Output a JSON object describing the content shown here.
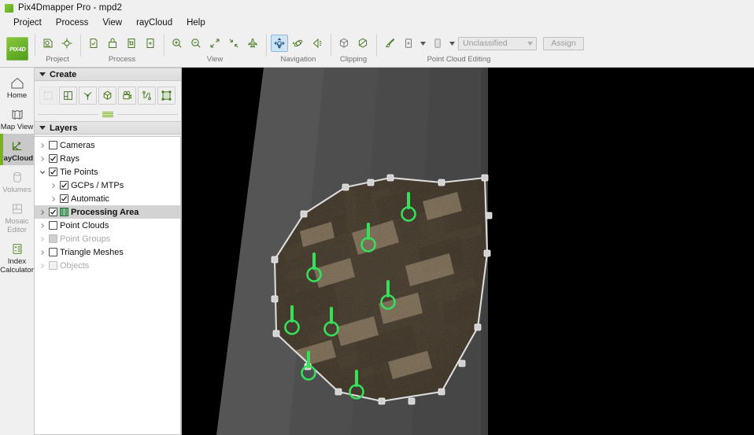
{
  "window": {
    "title": "Pix4Dmapper Pro - mpd2",
    "app_icon": "pix4d-logo-icon",
    "logo_text": "PIX4D"
  },
  "menubar": {
    "items": [
      {
        "label": "Project"
      },
      {
        "label": "Process"
      },
      {
        "label": "View"
      },
      {
        "label": "rayCloud"
      },
      {
        "label": "Help"
      }
    ]
  },
  "ribbon": {
    "groups": [
      {
        "label": "Project",
        "buttons": [
          {
            "name": "new-project-icon",
            "enabled": true,
            "active": false
          },
          {
            "name": "project-properties-icon",
            "enabled": true,
            "active": false
          }
        ]
      },
      {
        "label": "Process",
        "buttons": [
          {
            "name": "processing-options-icon",
            "enabled": true,
            "active": false
          },
          {
            "name": "local-processing-icon",
            "enabled": true,
            "active": false
          },
          {
            "name": "reoptimize-icon",
            "enabled": true,
            "active": false
          },
          {
            "name": "rematch-and-optimize-icon",
            "enabled": true,
            "active": false
          }
        ]
      },
      {
        "label": "View",
        "buttons": [
          {
            "name": "zoom-in-icon",
            "enabled": true,
            "active": false
          },
          {
            "name": "zoom-out-icon",
            "enabled": true,
            "active": false
          },
          {
            "name": "zoom-extents-icon",
            "enabled": true,
            "active": false
          },
          {
            "name": "zoom-selection-icon",
            "enabled": true,
            "active": false
          },
          {
            "name": "fly-through-icon",
            "enabled": true,
            "active": false
          }
        ]
      },
      {
        "label": "Navigation",
        "buttons": [
          {
            "name": "orbit-navigation-icon",
            "enabled": true,
            "active": true
          },
          {
            "name": "rotate-navigation-icon",
            "enabled": true,
            "active": false
          },
          {
            "name": "first-person-navigation-icon",
            "enabled": true,
            "active": false
          }
        ]
      },
      {
        "label": "Clipping",
        "buttons": [
          {
            "name": "clipping-box-icon",
            "enabled": true,
            "active": false
          },
          {
            "name": "clipping-plane-icon",
            "enabled": true,
            "active": false
          }
        ]
      },
      {
        "label": "Point Cloud Editing",
        "buttons": [
          {
            "name": "brush-tool-icon",
            "enabled": true,
            "active": false
          },
          {
            "name": "add-to-selection-icon",
            "enabled": true,
            "active": false
          },
          {
            "name": "selection-shape-icon",
            "enabled": true,
            "active": false
          }
        ],
        "classification_combo": {
          "name": "classification-combo",
          "value": "Unclassified",
          "enabled": false
        },
        "assign_button": {
          "name": "assign-button",
          "label": "Assign",
          "enabled": false
        }
      }
    ]
  },
  "rail": {
    "items": [
      {
        "label": "Home",
        "icon": "home-icon",
        "active": false,
        "enabled": true
      },
      {
        "label": "Map View",
        "icon": "map-view-icon",
        "active": false,
        "enabled": true
      },
      {
        "label": "rayCloud",
        "icon": "raycloud-icon",
        "active": true,
        "enabled": true
      },
      {
        "label": "Volumes",
        "icon": "volumes-icon",
        "active": false,
        "enabled": false
      },
      {
        "label": "Mosaic\nEditor",
        "icon": "mosaic-editor-icon",
        "active": false,
        "enabled": false
      },
      {
        "label": "Index\nCalculator",
        "icon": "index-calculator-icon",
        "active": false,
        "enabled": true
      }
    ],
    "labels": {
      "home": "Home",
      "map_view": "Map View",
      "raycloud": "rayCloud",
      "volumes": "Volumes",
      "mosaic_line1": "Mosaic",
      "mosaic_line2": "Editor",
      "index_line1": "Index",
      "index_line2": "Calculator"
    }
  },
  "create_panel": {
    "title": "Create",
    "collapsed": false,
    "buttons": [
      {
        "name": "create-selection-icon",
        "enabled": false
      },
      {
        "name": "create-orthoplane-icon",
        "enabled": true
      },
      {
        "name": "create-polyline-icon",
        "enabled": true
      },
      {
        "name": "create-object-icon",
        "enabled": true
      },
      {
        "name": "create-video-animation-icon",
        "enabled": true
      },
      {
        "name": "create-scale-constraint-icon",
        "enabled": true
      },
      {
        "name": "create-processing-area-icon",
        "enabled": true
      }
    ]
  },
  "layers_panel": {
    "title": "Layers",
    "collapsed": false,
    "rows": [
      {
        "label": "Cameras",
        "checked": false,
        "expanded": null,
        "indent": 0,
        "enabled": true,
        "selected": false,
        "icon": null
      },
      {
        "label": "Rays",
        "checked": true,
        "expanded": null,
        "indent": 0,
        "enabled": true,
        "selected": false,
        "icon": null
      },
      {
        "label": "Tie Points",
        "checked": true,
        "expanded": "open",
        "indent": 0,
        "enabled": true,
        "selected": false,
        "icon": null
      },
      {
        "label": "GCPs / MTPs",
        "checked": true,
        "expanded": "closed",
        "indent": 1,
        "enabled": true,
        "selected": false,
        "icon": null
      },
      {
        "label": "Automatic",
        "checked": true,
        "expanded": "closed",
        "indent": 1,
        "enabled": true,
        "selected": false,
        "icon": null
      },
      {
        "label": "Processing Area",
        "checked": true,
        "expanded": "closed",
        "indent": 0,
        "enabled": true,
        "selected": true,
        "icon": "processing-area-icon"
      },
      {
        "label": "Point Clouds",
        "checked": false,
        "expanded": "closed",
        "indent": 0,
        "enabled": true,
        "selected": false,
        "icon": null
      },
      {
        "label": "Point Groups",
        "checked": false,
        "expanded": "closed",
        "indent": 0,
        "enabled": false,
        "selected": false,
        "icon": null
      },
      {
        "label": "Triangle Meshes",
        "checked": false,
        "expanded": "closed",
        "indent": 0,
        "enabled": true,
        "selected": false,
        "icon": null
      },
      {
        "label": "Objects",
        "checked": false,
        "expanded": "closed",
        "indent": 0,
        "enabled": false,
        "selected": false,
        "icon": null
      }
    ]
  },
  "viewport": {
    "name": "raycloud-3d-viewport",
    "background_color": "#000000",
    "ground_color": "#4a4a4a",
    "processing_area_color": "#d8d8d8",
    "gcp_marker_color": "#35e05a",
    "gcp_marker_count": 8,
    "point_cloud_description": "aerial point cloud of urban archaeological site"
  }
}
